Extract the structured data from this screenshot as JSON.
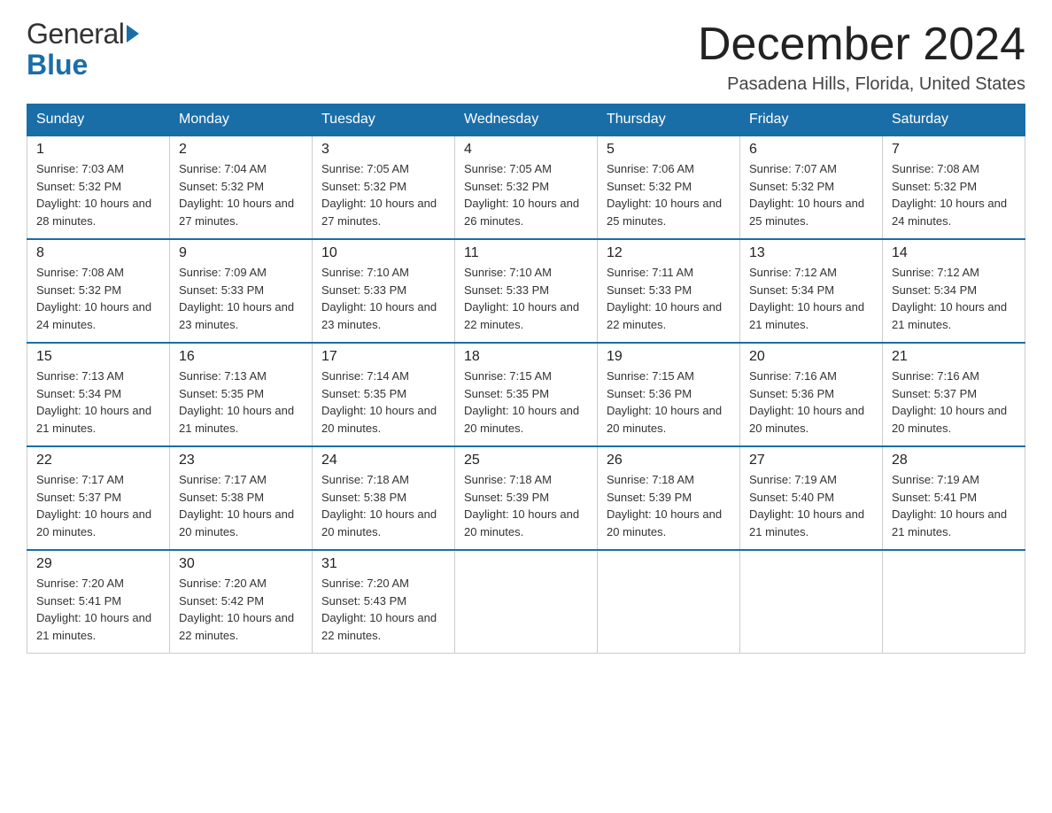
{
  "header": {
    "logo_general": "General",
    "logo_blue": "Blue",
    "title": "December 2024",
    "subtitle": "Pasadena Hills, Florida, United States"
  },
  "weekdays": [
    "Sunday",
    "Monday",
    "Tuesday",
    "Wednesday",
    "Thursday",
    "Friday",
    "Saturday"
  ],
  "weeks": [
    [
      {
        "day": "1",
        "sunrise": "7:03 AM",
        "sunset": "5:32 PM",
        "daylight": "10 hours and 28 minutes."
      },
      {
        "day": "2",
        "sunrise": "7:04 AM",
        "sunset": "5:32 PM",
        "daylight": "10 hours and 27 minutes."
      },
      {
        "day": "3",
        "sunrise": "7:05 AM",
        "sunset": "5:32 PM",
        "daylight": "10 hours and 27 minutes."
      },
      {
        "day": "4",
        "sunrise": "7:05 AM",
        "sunset": "5:32 PM",
        "daylight": "10 hours and 26 minutes."
      },
      {
        "day": "5",
        "sunrise": "7:06 AM",
        "sunset": "5:32 PM",
        "daylight": "10 hours and 25 minutes."
      },
      {
        "day": "6",
        "sunrise": "7:07 AM",
        "sunset": "5:32 PM",
        "daylight": "10 hours and 25 minutes."
      },
      {
        "day": "7",
        "sunrise": "7:08 AM",
        "sunset": "5:32 PM",
        "daylight": "10 hours and 24 minutes."
      }
    ],
    [
      {
        "day": "8",
        "sunrise": "7:08 AM",
        "sunset": "5:32 PM",
        "daylight": "10 hours and 24 minutes."
      },
      {
        "day": "9",
        "sunrise": "7:09 AM",
        "sunset": "5:33 PM",
        "daylight": "10 hours and 23 minutes."
      },
      {
        "day": "10",
        "sunrise": "7:10 AM",
        "sunset": "5:33 PM",
        "daylight": "10 hours and 23 minutes."
      },
      {
        "day": "11",
        "sunrise": "7:10 AM",
        "sunset": "5:33 PM",
        "daylight": "10 hours and 22 minutes."
      },
      {
        "day": "12",
        "sunrise": "7:11 AM",
        "sunset": "5:33 PM",
        "daylight": "10 hours and 22 minutes."
      },
      {
        "day": "13",
        "sunrise": "7:12 AM",
        "sunset": "5:34 PM",
        "daylight": "10 hours and 21 minutes."
      },
      {
        "day": "14",
        "sunrise": "7:12 AM",
        "sunset": "5:34 PM",
        "daylight": "10 hours and 21 minutes."
      }
    ],
    [
      {
        "day": "15",
        "sunrise": "7:13 AM",
        "sunset": "5:34 PM",
        "daylight": "10 hours and 21 minutes."
      },
      {
        "day": "16",
        "sunrise": "7:13 AM",
        "sunset": "5:35 PM",
        "daylight": "10 hours and 21 minutes."
      },
      {
        "day": "17",
        "sunrise": "7:14 AM",
        "sunset": "5:35 PM",
        "daylight": "10 hours and 20 minutes."
      },
      {
        "day": "18",
        "sunrise": "7:15 AM",
        "sunset": "5:35 PM",
        "daylight": "10 hours and 20 minutes."
      },
      {
        "day": "19",
        "sunrise": "7:15 AM",
        "sunset": "5:36 PM",
        "daylight": "10 hours and 20 minutes."
      },
      {
        "day": "20",
        "sunrise": "7:16 AM",
        "sunset": "5:36 PM",
        "daylight": "10 hours and 20 minutes."
      },
      {
        "day": "21",
        "sunrise": "7:16 AM",
        "sunset": "5:37 PM",
        "daylight": "10 hours and 20 minutes."
      }
    ],
    [
      {
        "day": "22",
        "sunrise": "7:17 AM",
        "sunset": "5:37 PM",
        "daylight": "10 hours and 20 minutes."
      },
      {
        "day": "23",
        "sunrise": "7:17 AM",
        "sunset": "5:38 PM",
        "daylight": "10 hours and 20 minutes."
      },
      {
        "day": "24",
        "sunrise": "7:18 AM",
        "sunset": "5:38 PM",
        "daylight": "10 hours and 20 minutes."
      },
      {
        "day": "25",
        "sunrise": "7:18 AM",
        "sunset": "5:39 PM",
        "daylight": "10 hours and 20 minutes."
      },
      {
        "day": "26",
        "sunrise": "7:18 AM",
        "sunset": "5:39 PM",
        "daylight": "10 hours and 20 minutes."
      },
      {
        "day": "27",
        "sunrise": "7:19 AM",
        "sunset": "5:40 PM",
        "daylight": "10 hours and 21 minutes."
      },
      {
        "day": "28",
        "sunrise": "7:19 AM",
        "sunset": "5:41 PM",
        "daylight": "10 hours and 21 minutes."
      }
    ],
    [
      {
        "day": "29",
        "sunrise": "7:20 AM",
        "sunset": "5:41 PM",
        "daylight": "10 hours and 21 minutes."
      },
      {
        "day": "30",
        "sunrise": "7:20 AM",
        "sunset": "5:42 PM",
        "daylight": "10 hours and 22 minutes."
      },
      {
        "day": "31",
        "sunrise": "7:20 AM",
        "sunset": "5:43 PM",
        "daylight": "10 hours and 22 minutes."
      },
      null,
      null,
      null,
      null
    ]
  ]
}
